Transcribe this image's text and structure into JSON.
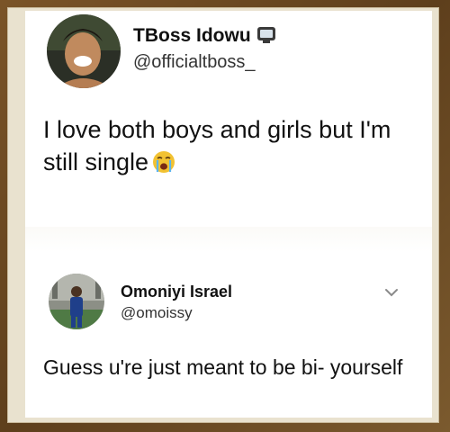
{
  "tweet": {
    "author_name": "TBoss Idowu",
    "author_handle": "@officialtboss_",
    "text": "I love both boys and girls but I'm still single",
    "badge_icon": "television-icon",
    "text_emoji": "loudly-crying-face-icon"
  },
  "reply": {
    "author_name": "Omoniyi Israel",
    "author_handle": "@omoissy",
    "text": "Guess u're just meant to be bi- yourself",
    "menu_icon": "chevron-down-icon"
  },
  "colors": {
    "frame": "#6b4a23",
    "mat": "#e9e2cf",
    "card": "#ffffff",
    "text": "#111111"
  }
}
